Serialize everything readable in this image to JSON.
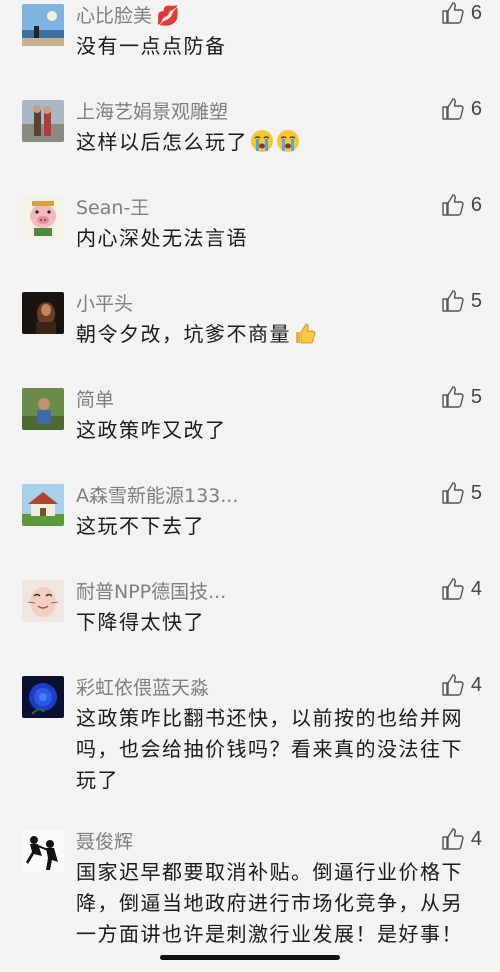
{
  "comments": [
    {
      "nickname": "心比脸美",
      "nick_emoji": "lips-emoji",
      "content": "没有一点点防备",
      "likes": "6",
      "avatar": "beach-photo-avatar"
    },
    {
      "nickname": "上海艺娟景观雕塑",
      "content": "这样以后怎么玩了",
      "content_emoji": [
        "crying-face-emoji",
        "crying-face-emoji"
      ],
      "likes": "6",
      "avatar": "couple-photo-avatar"
    },
    {
      "nickname": "Sean-王",
      "content": "内心深处无法言语",
      "likes": "6",
      "avatar": "cartoon-pig-avatar"
    },
    {
      "nickname": "小平头",
      "content": "朝令夕改，坑爹不商量",
      "content_emoji": [
        "thumbs-up-emoji"
      ],
      "likes": "5",
      "avatar": "dark-portrait-avatar"
    },
    {
      "nickname": "简单",
      "content": "这政策咋又改了",
      "likes": "5",
      "avatar": "outdoor-person-avatar"
    },
    {
      "nickname": "A森雪新能源133...",
      "content": "这玩不下去了",
      "likes": "5",
      "avatar": "house-photo-avatar"
    },
    {
      "nickname": "耐普NPP德国技...",
      "content": "下降得太快了",
      "likes": "4",
      "avatar": "cat-face-avatar"
    },
    {
      "nickname": "彩虹依偎蓝天淼",
      "content": "这政策咋比翻书还快，以前按的也给并网吗，也会给抽价钱吗？看来真的没法往下玩了",
      "likes": "4",
      "avatar": "blue-rose-avatar"
    },
    {
      "nickname": "聂俊辉",
      "content": "国家迟早都要取消补贴。倒逼行业价格下降，倒逼当地政府进行市场化竞争，从另一方面讲也许是刺激行业发展！是好事！",
      "likes": "4",
      "avatar": "silhouette-avatar"
    }
  ]
}
